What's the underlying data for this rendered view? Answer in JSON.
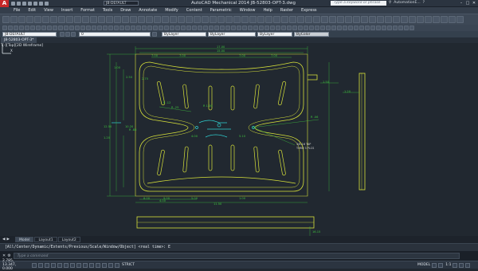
{
  "app": {
    "title": "AutoCAD Mechanical 2014  JB-52803-OPT-3.dwg",
    "workspace": "JB-DEFAULT",
    "search_placeholder": "Type a keyword or phrase",
    "user": "AutomationE...",
    "logo": "A"
  },
  "menu": [
    "File",
    "Edit",
    "View",
    "Insert",
    "Format",
    "Tools",
    "Draw",
    "Annotate",
    "Modify",
    "Content",
    "Parametric",
    "Window",
    "Help",
    "Raster",
    "Express"
  ],
  "toolbar3": {
    "style_combo": "JB-DEFAULT",
    "layer_combo": "0",
    "color_combo": "ByLayer",
    "linetype_combo": "ByLayer",
    "lineweight_combo": "ByLayer",
    "plot_combo": "ByColor"
  },
  "document_tab": "JB-52803-OPT-3*",
  "viewport_label": "[-][Top][2D Wireframe]",
  "layout_tabs": [
    "Model",
    "Layout1",
    "Layout2"
  ],
  "command": {
    "history": "[All/Center/Dynamic/Extents/Previous/Scale/Window/Object] <real time>: E",
    "placeholder": "Type a command"
  },
  "status": {
    "coords": "2.785, 13.347, 0.000",
    "strict": "STRICT",
    "model": "MODEL",
    "scale": "1:1"
  },
  "drawing": {
    "colors": {
      "geometry": "#d8e23a",
      "dimension": "#3ec23e",
      "highlight": "#2fd4d4",
      "leader": "#d8d8d8",
      "background": "#212830"
    },
    "dims": [
      "17.00",
      "15.00",
      "7.00",
      "7.00",
      "7.00",
      "7.00",
      "1.00",
      "2.50",
      "2.75",
      "12.50",
      "10.20",
      "1.20",
      "R .88",
      "R .06",
      "8.00",
      "9.00",
      "5.00",
      "1.00",
      "R 1.00",
      "4.00",
      "5.10",
      "4.00",
      "11.50",
      "1.50",
      "1.20",
      "R .12",
      "R .25",
      "16.15"
    ],
    "callout": "3/8-16 TAP\nTHRU 3 PLCS"
  }
}
